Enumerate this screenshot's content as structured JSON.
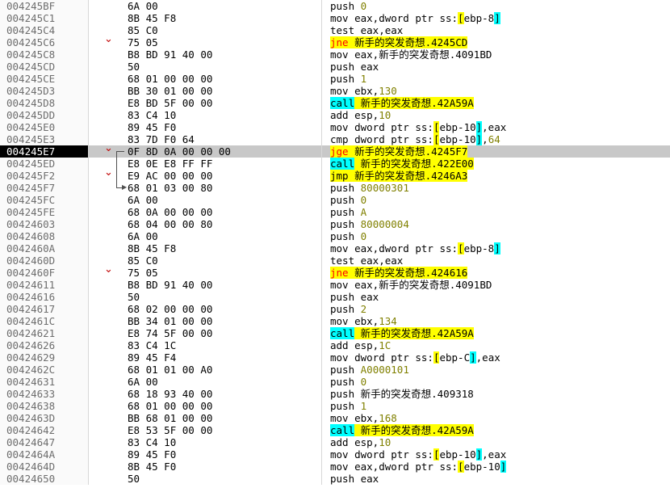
{
  "colors": {
    "selected_row": "#c8c8c8",
    "selected_address_bg": "#000000",
    "jump_highlight": "#ffff00",
    "call_highlight": "#00ffff",
    "conditional_jump_text": "#ff0000",
    "branch_arrow": "#c00000",
    "number_text": "#808000"
  },
  "rows": [
    {
      "address": "004245BF",
      "opcode": "6A",
      "rest": "00",
      "tokens": [
        {
          "t": "push "
        },
        {
          "t": "0",
          "c": "num"
        }
      ]
    },
    {
      "address": "004245C1",
      "opcode": "8B",
      "rest": "45 F8",
      "tokens": [
        {
          "t": "mov eax,dword ptr ss:"
        },
        {
          "t": "[",
          "c": "hl-y"
        },
        {
          "t": "ebp-8"
        },
        {
          "t": "]",
          "c": "hl-c"
        }
      ]
    },
    {
      "address": "004245C4",
      "opcode": "85",
      "rest": "C0",
      "tokens": [
        {
          "t": "test eax,eax"
        }
      ]
    },
    {
      "address": "004245C6",
      "opcode": "75",
      "rest": "05",
      "arrow": "chevron-down",
      "mnemonic": "jne",
      "mclass": "jcc",
      "tokens": [
        {
          "t": " 新手的突发奇想.4245CD",
          "c": "hl-y"
        }
      ]
    },
    {
      "address": "004245C8",
      "opcode": "B8",
      "rest": "BD 91 40 00",
      "tokens": [
        {
          "t": "mov eax,新手的突发奇想.4091BD"
        }
      ]
    },
    {
      "address": "004245CD",
      "opcode": "50",
      "rest": "",
      "tokens": [
        {
          "t": "push eax"
        }
      ]
    },
    {
      "address": "004245CE",
      "opcode": "68",
      "rest": "01 00 00 00",
      "tokens": [
        {
          "t": "push "
        },
        {
          "t": "1",
          "c": "num"
        }
      ]
    },
    {
      "address": "004245D3",
      "opcode": "BB",
      "rest": "30 01 00 00",
      "tokens": [
        {
          "t": "mov ebx,"
        },
        {
          "t": "130",
          "c": "num"
        }
      ]
    },
    {
      "address": "004245D8",
      "opcode": "E8",
      "rest": "BD 5F 00 00",
      "mnemonic": "call",
      "mclass": "call",
      "tokens": [
        {
          "t": " 新手的突发奇想.42A59A",
          "c": "hl-y"
        }
      ]
    },
    {
      "address": "004245DD",
      "opcode": "83",
      "rest": "C4 10",
      "tokens": [
        {
          "t": "add esp,"
        },
        {
          "t": "10",
          "c": "num"
        }
      ]
    },
    {
      "address": "004245E0",
      "opcode": "89",
      "rest": "45 F0",
      "tokens": [
        {
          "t": "mov dword ptr ss:"
        },
        {
          "t": "[",
          "c": "hl-y"
        },
        {
          "t": "ebp-10"
        },
        {
          "t": "]",
          "c": "hl-c"
        },
        {
          "t": ",eax"
        }
      ]
    },
    {
      "address": "004245E3",
      "opcode": "83",
      "rest": "7D F0 64",
      "tokens": [
        {
          "t": "cmp dword ptr ss:"
        },
        {
          "t": "[",
          "c": "hl-y"
        },
        {
          "t": "ebp-10"
        },
        {
          "t": "]",
          "c": "hl-c"
        },
        {
          "t": ","
        },
        {
          "t": "64",
          "c": "num"
        }
      ]
    },
    {
      "address": "004245E7",
      "opcode": "0F",
      "rest": "8D 0A 00 00 00",
      "selected": true,
      "arrow": "chevron-down",
      "mnemonic": "jge",
      "mclass": "jcc",
      "tokens": [
        {
          "t": " 新手的突发奇想.4245F7",
          "c": "hl-y"
        }
      ]
    },
    {
      "address": "004245ED",
      "opcode": "E8",
      "rest": "0E E8 FF FF",
      "mnemonic": "call",
      "mclass": "call",
      "tokens": [
        {
          "t": " 新手的突发奇想.422E00",
          "c": "hl-y"
        }
      ]
    },
    {
      "address": "004245F2",
      "opcode": "E9",
      "rest": "AC 00 00 00",
      "arrow": "chevron-down",
      "mnemonic": "jmp",
      "mclass": "jmp",
      "tokens": [
        {
          "t": " 新手的突发奇想.4246A3",
          "c": "hl-y"
        }
      ]
    },
    {
      "address": "004245F7",
      "opcode": "68",
      "rest": "01 03 00 80",
      "tokens": [
        {
          "t": "push "
        },
        {
          "t": "80000301",
          "c": "num"
        }
      ]
    },
    {
      "address": "004245FC",
      "opcode": "6A",
      "rest": "00",
      "tokens": [
        {
          "t": "push "
        },
        {
          "t": "0",
          "c": "num"
        }
      ]
    },
    {
      "address": "004245FE",
      "opcode": "68",
      "rest": "0A 00 00 00",
      "tokens": [
        {
          "t": "push "
        },
        {
          "t": "A",
          "c": "num"
        }
      ]
    },
    {
      "address": "00424603",
      "opcode": "68",
      "rest": "04 00 00 80",
      "tokens": [
        {
          "t": "push "
        },
        {
          "t": "80000004",
          "c": "num"
        }
      ]
    },
    {
      "address": "00424608",
      "opcode": "6A",
      "rest": "00",
      "tokens": [
        {
          "t": "push "
        },
        {
          "t": "0",
          "c": "num"
        }
      ]
    },
    {
      "address": "0042460A",
      "opcode": "8B",
      "rest": "45 F8",
      "tokens": [
        {
          "t": "mov eax,dword ptr ss:"
        },
        {
          "t": "[",
          "c": "hl-y"
        },
        {
          "t": "ebp-8"
        },
        {
          "t": "]",
          "c": "hl-c"
        }
      ]
    },
    {
      "address": "0042460D",
      "opcode": "85",
      "rest": "C0",
      "tokens": [
        {
          "t": "test eax,eax"
        }
      ]
    },
    {
      "address": "0042460F",
      "opcode": "75",
      "rest": "05",
      "arrow": "chevron-down",
      "mnemonic": "jne",
      "mclass": "jcc",
      "tokens": [
        {
          "t": " 新手的突发奇想.424616",
          "c": "hl-y"
        }
      ]
    },
    {
      "address": "00424611",
      "opcode": "B8",
      "rest": "BD 91 40 00",
      "tokens": [
        {
          "t": "mov eax,新手的突发奇想.4091BD"
        }
      ]
    },
    {
      "address": "00424616",
      "opcode": "50",
      "rest": "",
      "tokens": [
        {
          "t": "push eax"
        }
      ]
    },
    {
      "address": "00424617",
      "opcode": "68",
      "rest": "02 00 00 00",
      "tokens": [
        {
          "t": "push "
        },
        {
          "t": "2",
          "c": "num"
        }
      ]
    },
    {
      "address": "0042461C",
      "opcode": "BB",
      "rest": "34 01 00 00",
      "tokens": [
        {
          "t": "mov ebx,"
        },
        {
          "t": "134",
          "c": "num"
        }
      ]
    },
    {
      "address": "00424621",
      "opcode": "E8",
      "rest": "74 5F 00 00",
      "mnemonic": "call",
      "mclass": "call",
      "tokens": [
        {
          "t": " 新手的突发奇想.42A59A",
          "c": "hl-y"
        }
      ]
    },
    {
      "address": "00424626",
      "opcode": "83",
      "rest": "C4 1C",
      "tokens": [
        {
          "t": "add esp,"
        },
        {
          "t": "1C",
          "c": "num"
        }
      ]
    },
    {
      "address": "00424629",
      "opcode": "89",
      "rest": "45 F4",
      "tokens": [
        {
          "t": "mov dword ptr ss:"
        },
        {
          "t": "[",
          "c": "hl-y"
        },
        {
          "t": "ebp-C"
        },
        {
          "t": "]",
          "c": "hl-c"
        },
        {
          "t": ",eax"
        }
      ]
    },
    {
      "address": "0042462C",
      "opcode": "68",
      "rest": "01 01 00 A0",
      "tokens": [
        {
          "t": "push "
        },
        {
          "t": "A0000101",
          "c": "num"
        }
      ]
    },
    {
      "address": "00424631",
      "opcode": "6A",
      "rest": "00",
      "tokens": [
        {
          "t": "push "
        },
        {
          "t": "0",
          "c": "num"
        }
      ]
    },
    {
      "address": "00424633",
      "opcode": "68",
      "rest": "18 93 40 00",
      "tokens": [
        {
          "t": "push 新手的突发奇想.409318"
        }
      ]
    },
    {
      "address": "00424638",
      "opcode": "68",
      "rest": "01 00 00 00",
      "tokens": [
        {
          "t": "push "
        },
        {
          "t": "1",
          "c": "num"
        }
      ]
    },
    {
      "address": "0042463D",
      "opcode": "BB",
      "rest": "68 01 00 00",
      "tokens": [
        {
          "t": "mov ebx,"
        },
        {
          "t": "168",
          "c": "num"
        }
      ]
    },
    {
      "address": "00424642",
      "opcode": "E8",
      "rest": "53 5F 00 00",
      "mnemonic": "call",
      "mclass": "call",
      "tokens": [
        {
          "t": " 新手的突发奇想.42A59A",
          "c": "hl-y"
        }
      ]
    },
    {
      "address": "00424647",
      "opcode": "83",
      "rest": "C4 10",
      "tokens": [
        {
          "t": "add esp,"
        },
        {
          "t": "10",
          "c": "num"
        }
      ]
    },
    {
      "address": "0042464A",
      "opcode": "89",
      "rest": "45 F0",
      "tokens": [
        {
          "t": "mov dword ptr ss:"
        },
        {
          "t": "[",
          "c": "hl-y"
        },
        {
          "t": "ebp-10"
        },
        {
          "t": "]",
          "c": "hl-c"
        },
        {
          "t": ",eax"
        }
      ]
    },
    {
      "address": "0042464D",
      "opcode": "8B",
      "rest": "45 F0",
      "tokens": [
        {
          "t": "mov eax,dword ptr ss:"
        },
        {
          "t": "[",
          "c": "hl-y"
        },
        {
          "t": "ebp-10"
        },
        {
          "t": "]",
          "c": "hl-c"
        }
      ]
    },
    {
      "address": "00424650",
      "opcode": "50",
      "rest": "",
      "tokens": [
        {
          "t": "push eax"
        }
      ]
    }
  ]
}
